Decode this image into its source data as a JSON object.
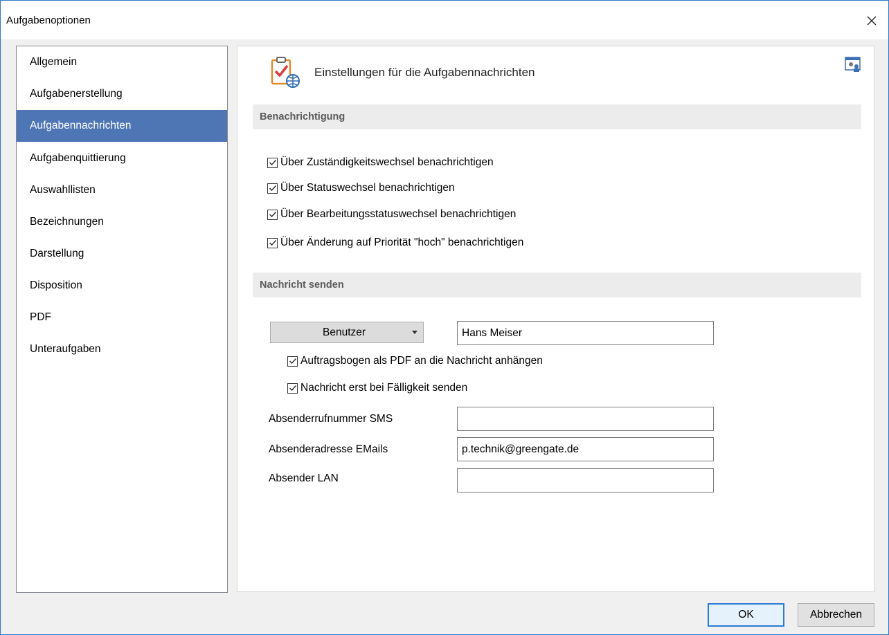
{
  "window": {
    "title": "Aufgabenoptionen"
  },
  "sidebar": {
    "items": [
      {
        "label": "Allgemein",
        "active": false
      },
      {
        "label": "Aufgabenerstellung",
        "active": false
      },
      {
        "label": "Aufgabennachrichten",
        "active": true
      },
      {
        "label": "Aufgabenquittierung",
        "active": false
      },
      {
        "label": "Auswahllisten",
        "active": false
      },
      {
        "label": "Bezeichnungen",
        "active": false
      },
      {
        "label": "Darstellung",
        "active": false
      },
      {
        "label": "Disposition",
        "active": false
      },
      {
        "label": "PDF",
        "active": false
      },
      {
        "label": "Unteraufgaben",
        "active": false
      }
    ]
  },
  "content": {
    "title": "Einstellungen für die Aufgabennachrichten",
    "notification_section": {
      "heading": "Benachrichtigung",
      "checkboxes": [
        {
          "label": "Über Zuständigkeitswechsel benachrichtigen",
          "checked": true
        },
        {
          "label": "Über Statuswechsel  benachrichtigen",
          "checked": true
        },
        {
          "label": "Über Bearbeitungsstatuswechsel  benachrichtigen",
          "checked": true
        },
        {
          "label": "Über Änderung auf Priorität \"hoch\" benachrichtigen",
          "checked": true
        }
      ]
    },
    "send_section": {
      "heading": "Nachricht senden",
      "recipient_type": "Benutzer",
      "recipient_value": "Hans Meiser",
      "checkboxes": [
        {
          "label": "Auftragsbogen als PDF an die Nachricht anhängen",
          "checked": true
        },
        {
          "label": "Nachricht erst bei Fälligkeit senden",
          "checked": true
        }
      ],
      "fields": [
        {
          "label": "Absenderrufnummer SMS",
          "value": ""
        },
        {
          "label": "Absenderadresse EMails",
          "value": "p.technik@greengate.de"
        },
        {
          "label": "Absender LAN",
          "value": ""
        }
      ]
    }
  },
  "footer": {
    "ok_label": "OK",
    "cancel_label": "Abbrechen"
  },
  "colors": {
    "accent": "#4f76b4",
    "window_border": "#2b79c9",
    "check_mark": "#333333"
  }
}
